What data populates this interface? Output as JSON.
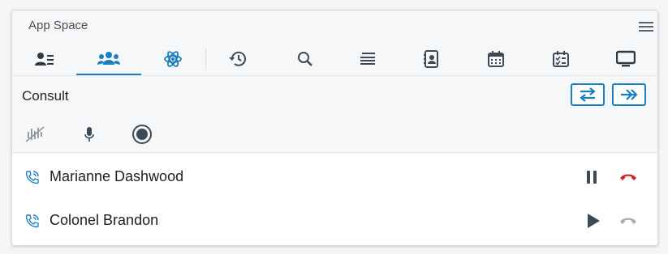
{
  "app": {
    "title": "App Space"
  },
  "toolbar": {
    "tabs": [
      {
        "icon": "contact-card-icon",
        "active": false
      },
      {
        "icon": "people-group-icon",
        "active": true
      },
      {
        "icon": "atom-icon",
        "active": false
      },
      {
        "icon": "history-icon",
        "active": false
      },
      {
        "icon": "search-icon",
        "active": false
      },
      {
        "icon": "queue-list-icon",
        "active": false
      },
      {
        "icon": "address-book-icon",
        "active": false
      },
      {
        "icon": "calendar-icon",
        "active": false
      },
      {
        "icon": "checklist-calendar-icon",
        "active": false
      },
      {
        "icon": "monitor-icon",
        "active": false
      }
    ]
  },
  "consult": {
    "title": "Consult",
    "actions": [
      {
        "icon": "transfer-icon"
      },
      {
        "icon": "forward-icon"
      }
    ],
    "controls": [
      {
        "icon": "audio-muted-icon"
      },
      {
        "icon": "microphone-icon"
      },
      {
        "icon": "record-icon"
      }
    ]
  },
  "calls": [
    {
      "name": "Marianne Dashwood",
      "state": "active",
      "controls": [
        "pause-icon",
        "hangup-icon"
      ]
    },
    {
      "name": "Colonel Brandon",
      "state": "held",
      "controls": [
        "play-icon",
        "hangup-disabled-icon"
      ]
    }
  ],
  "colors": {
    "accent": "#1a7fc1",
    "hangup_active": "#d9232e",
    "hangup_disabled": "#a9adb2",
    "icon_dark": "#3d4a56"
  }
}
